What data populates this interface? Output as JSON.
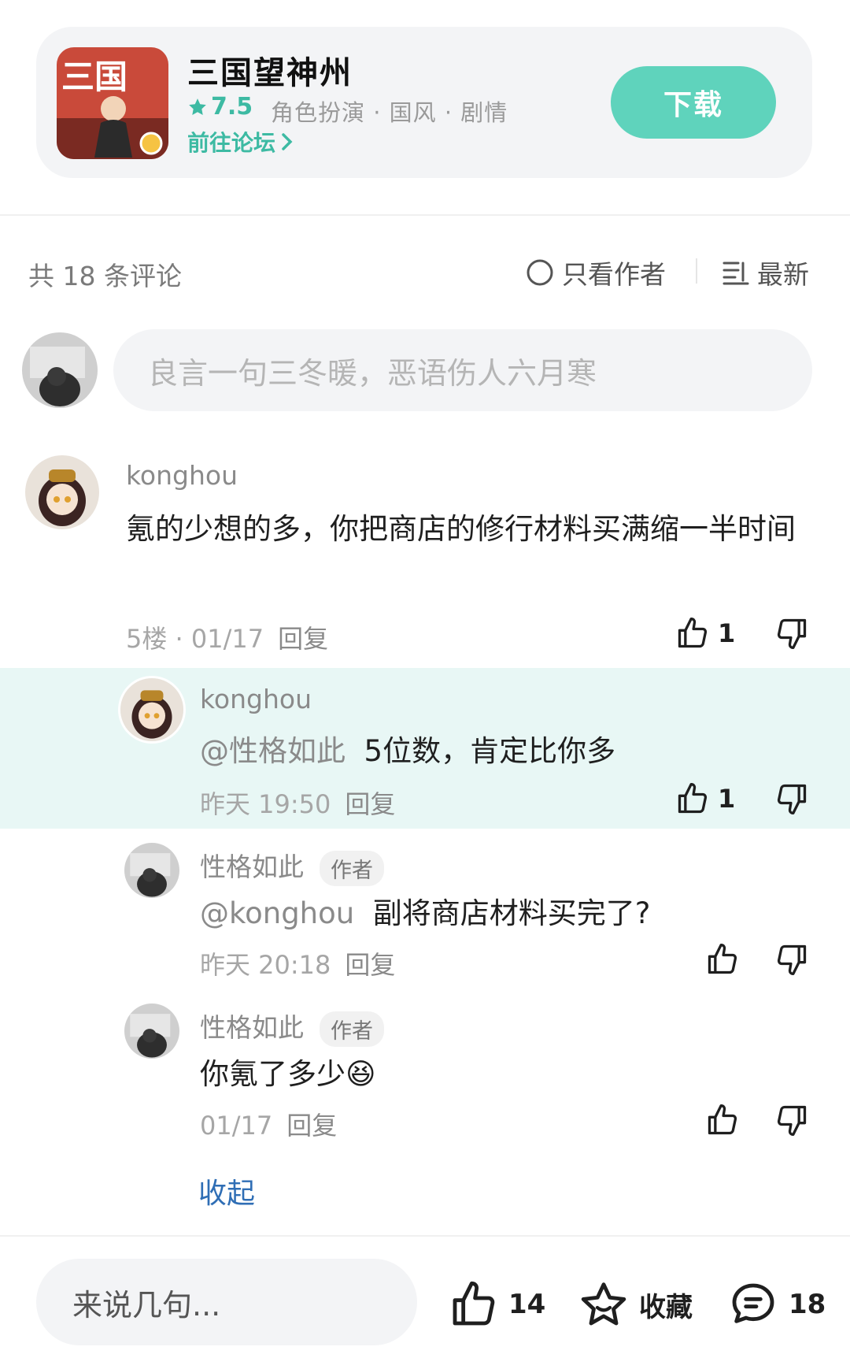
{
  "game": {
    "icon_text": "三国",
    "title": "三国望神州",
    "rating": "7.5",
    "tags": "角色扮演 · 国风 · 剧情",
    "forum_link": "前往论坛",
    "download_label": "下载"
  },
  "comments_header": {
    "count_text": "共 18 条评论",
    "author_only_label": "只看作者",
    "sort_label": "最新"
  },
  "input": {
    "placeholder": "良言一句三冬暖，恶语伤人六月寒"
  },
  "comments": [
    {
      "user": "konghou",
      "text": "氪的少想的多，你把商店的修行材料买满缩一半时间",
      "floor_date": "5楼 · 01/17",
      "reply_label": "回复",
      "likes": "1"
    },
    {
      "user": "konghou",
      "mention": "@性格如此",
      "text": "5位数，肯定比你多",
      "time": "昨天 19:50",
      "reply_label": "回复",
      "likes": "1"
    },
    {
      "user": "性格如此",
      "badge": "作者",
      "mention": "@konghou",
      "text": "副将商店材料买完了?",
      "time": "昨天 20:18",
      "reply_label": "回复"
    },
    {
      "user": "性格如此",
      "badge": "作者",
      "text": "你氪了多少",
      "emoji": "😆",
      "time": "01/17",
      "reply_label": "回复"
    }
  ],
  "collapse_label": "收起",
  "bottom_bar": {
    "placeholder": "来说几句...",
    "like_count": "14",
    "favorite_label": "收藏",
    "comment_count": "18"
  },
  "colors": {
    "accent": "#5fd3bc",
    "accent_text": "#3dbaa3",
    "link": "#2f6eb5",
    "highlight_bg": "#e8f7f5"
  },
  "icons": [
    "star-icon",
    "chevron-right-icon",
    "circle-radio-icon",
    "sort-list-icon",
    "thumb-up-icon",
    "thumb-down-icon",
    "star-outline-icon",
    "comment-bubble-icon"
  ]
}
